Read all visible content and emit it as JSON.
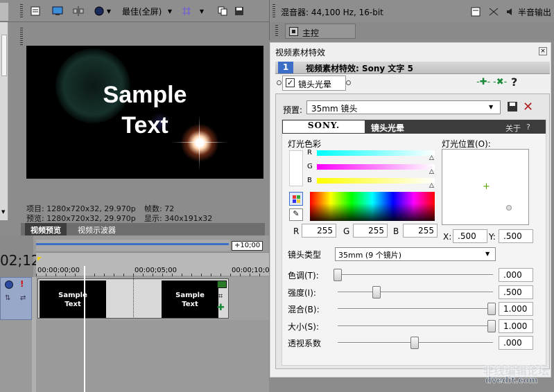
{
  "preview": {
    "toolbar": {
      "quality_label": "最佳(全屏)"
    },
    "sample_text": [
      "Sample",
      "Text"
    ],
    "info": {
      "project": "项目: 1280x720x32, 29.970p",
      "frames": "帧数: 72",
      "preview": "预览: 1280x720x32, 29.970p",
      "display": "显示: 340x191x32"
    },
    "tabs": [
      "视频预览",
      "视频示波器"
    ]
  },
  "mixer": {
    "title": "混音器: 44,100 Hz, 16-bit",
    "half_output": "半音输出",
    "master_label": "主控"
  },
  "timeline": {
    "timecode_partial": "02;12",
    "length_badge": "+10;00",
    "ruler": [
      "00:00;00;00",
      "00:00;05;00",
      "00:00;10;0"
    ],
    "clip_text": [
      "Sample",
      "Text"
    ]
  },
  "fx_dialog": {
    "title": "视频素材特效",
    "chain_number": "1",
    "chain_title": "视频素材特效: Sony 文字 5",
    "plugin_name": "镜头光晕",
    "preset_label": "预置:",
    "preset_value": "35mm 镜头",
    "sony_logo": "SONY.",
    "plugin_header": "镜头光晕",
    "about": "关于",
    "help_mark": "?",
    "light_color_label": "灯光色彩",
    "light_pos_label": "灯光位置(O):",
    "channels": [
      "R",
      "G",
      "B"
    ],
    "r_label": "R",
    "r_value": "255",
    "g_label": "G",
    "g_value": "255",
    "b_label": "B",
    "b_value": "255",
    "x_label": "X:",
    "x_value": ".500",
    "y_label": "Y:",
    "y_value": ".500",
    "lens_type_label": "镜头类型",
    "lens_type_value": "35mm (9 个镜片)",
    "params": [
      {
        "label": "色调(T):",
        "value": ".000",
        "level": 0.0
      },
      {
        "label": "强度(I):",
        "value": ".500",
        "level": 0.25
      },
      {
        "label": "混合(B):",
        "value": "1.000",
        "level": 1.0
      },
      {
        "label": "大小(S):",
        "value": "1.000",
        "level": 1.0
      },
      {
        "label": "透视系数",
        "value": ".000",
        "level": 0.5
      }
    ]
  },
  "watermark": {
    "line1": "非线编辑论坛",
    "line2": "dvedit.com"
  },
  "colors": {
    "panel_gray": "#8c8c8c",
    "dialog_bg": "#f0f0f0",
    "header_dark": "#3c3c3c",
    "accent_blue": "#3c6ec8"
  }
}
